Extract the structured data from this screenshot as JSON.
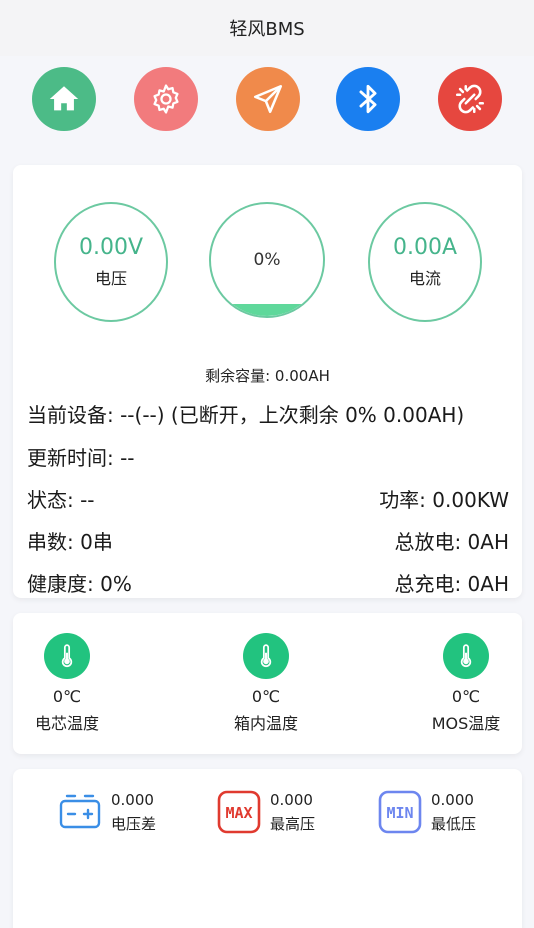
{
  "app": {
    "title": "轻风BMS"
  },
  "toolbar": [
    {
      "name": "home-button",
      "icon": "home-icon",
      "color": "#4cbb87"
    },
    {
      "name": "settings-button",
      "icon": "gear-icon",
      "color": "#f27b7d"
    },
    {
      "name": "send-button",
      "icon": "paper-plane-icon",
      "color": "#f08a4b"
    },
    {
      "name": "bluetooth-button",
      "icon": "bluetooth-icon",
      "color": "#1a7ff0"
    },
    {
      "name": "disconnect-button",
      "icon": "broken-link-icon",
      "color": "#e6473f"
    }
  ],
  "gauges": {
    "voltage": {
      "value": "0.00V",
      "label": "电压"
    },
    "soc": {
      "value": "0%",
      "fill_fraction": 0
    },
    "current": {
      "value": "0.00A",
      "label": "电流"
    }
  },
  "info": {
    "capacity": "剩余容量: 0.00AH",
    "device": "当前设备: --(--) (已断开，上次剩余 0% 0.00AH)",
    "update_time": "更新时间: --",
    "status": "状态: --",
    "power": "功率: 0.00KW",
    "cells": "串数: 0串",
    "total_discharge": "总放电: 0AH",
    "health": "健康度: 0%",
    "total_charge": "总充电: 0AH"
  },
  "temperatures": [
    {
      "value": "0℃",
      "label": "电芯温度",
      "icon": "thermometer-icon"
    },
    {
      "value": "0℃",
      "label": "箱内温度",
      "icon": "thermometer-icon"
    },
    {
      "value": "0℃",
      "label": "MOS温度",
      "icon": "thermometer-icon"
    }
  ],
  "voltages": [
    {
      "value": "0.000",
      "label": "电压差",
      "icon": "battery-icon"
    },
    {
      "value": "0.000",
      "label": "最高压",
      "icon": "max-icon"
    },
    {
      "value": "0.000",
      "label": "最低压",
      "icon": "min-icon"
    }
  ],
  "colors": {
    "accent_green": "#45b48b",
    "gauge_border": "#6cc9a1",
    "thermo_green": "#22c37f"
  }
}
